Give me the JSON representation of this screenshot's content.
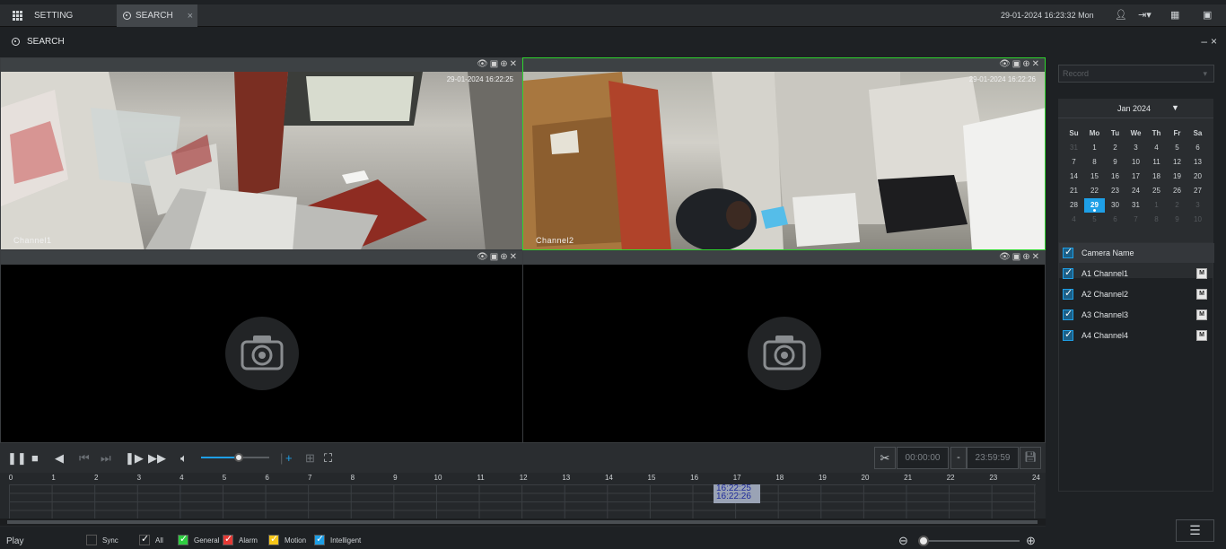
{
  "topbar": {
    "tabs": [
      {
        "label": "SETTING"
      },
      {
        "label": "SEARCH"
      }
    ],
    "datetime": "29-01-2024 16:23:32 Mon"
  },
  "window": {
    "title": "SEARCH"
  },
  "panes": [
    {
      "channel_label": "Channel1",
      "osd_time": "29-01-2024 16:22:25",
      "has_video": true,
      "selected": false
    },
    {
      "channel_label": "Channel2",
      "osd_time": "29-01-2024 16:22:26",
      "has_video": true,
      "selected": true
    },
    {
      "channel_label": "",
      "osd_time": "",
      "has_video": false,
      "selected": false
    },
    {
      "channel_label": "",
      "osd_time": "",
      "has_video": false,
      "selected": false
    }
  ],
  "controls": {
    "volume_level": 0.55,
    "start_time": "00:00:00",
    "end_time": "23:59:59",
    "dash": "-"
  },
  "timeline": {
    "hours": [
      "0",
      "1",
      "2",
      "3",
      "4",
      "5",
      "6",
      "7",
      "8",
      "9",
      "10",
      "11",
      "12",
      "13",
      "14",
      "15",
      "16",
      "17",
      "18",
      "19",
      "20",
      "21",
      "22",
      "23",
      "24"
    ],
    "cursor_times": [
      "16:22:25",
      "16:22:26"
    ]
  },
  "legend": {
    "play_label": "Play",
    "items": [
      {
        "label": "Sync",
        "color": "#1e2124",
        "checked": false
      },
      {
        "label": "All",
        "color": "#1e2124",
        "checked": true
      },
      {
        "label": "General",
        "color": "#2ecc40",
        "checked": true
      },
      {
        "label": "Alarm",
        "color": "#e53935",
        "checked": true
      },
      {
        "label": "Motion",
        "color": "#f5c518",
        "checked": true
      },
      {
        "label": "Intelligent",
        "color": "#1e9fe6",
        "checked": true
      }
    ]
  },
  "right_panel": {
    "record_placeholder": "Record",
    "calendar": {
      "month": "Jan 2024",
      "weekdays": [
        "Su",
        "Mo",
        "Tu",
        "We",
        "Th",
        "Fr",
        "Sa"
      ],
      "days": [
        {
          "d": "31",
          "out": true
        },
        {
          "d": "1"
        },
        {
          "d": "2"
        },
        {
          "d": "3"
        },
        {
          "d": "4"
        },
        {
          "d": "5"
        },
        {
          "d": "6"
        },
        {
          "d": "7"
        },
        {
          "d": "8"
        },
        {
          "d": "9"
        },
        {
          "d": "10"
        },
        {
          "d": "11"
        },
        {
          "d": "12"
        },
        {
          "d": "13"
        },
        {
          "d": "14"
        },
        {
          "d": "15"
        },
        {
          "d": "16"
        },
        {
          "d": "17"
        },
        {
          "d": "18"
        },
        {
          "d": "19"
        },
        {
          "d": "20"
        },
        {
          "d": "21"
        },
        {
          "d": "22"
        },
        {
          "d": "23"
        },
        {
          "d": "24"
        },
        {
          "d": "25"
        },
        {
          "d": "26"
        },
        {
          "d": "27"
        },
        {
          "d": "28"
        },
        {
          "d": "29",
          "today": true
        },
        {
          "d": "30"
        },
        {
          "d": "31"
        },
        {
          "d": "1",
          "out": true
        },
        {
          "d": "2",
          "out": true
        },
        {
          "d": "3",
          "out": true
        },
        {
          "d": "4",
          "out": true
        },
        {
          "d": "5",
          "out": true
        },
        {
          "d": "6",
          "out": true
        },
        {
          "d": "7",
          "out": true
        },
        {
          "d": "8",
          "out": true
        },
        {
          "d": "9",
          "out": true
        },
        {
          "d": "10",
          "out": true
        }
      ]
    },
    "camera_header": "Camera Name",
    "cameras": [
      "A1 Channel1",
      "A2 Channel2",
      "A3 Channel3",
      "A4 Channel4"
    ],
    "m_label": "M"
  }
}
